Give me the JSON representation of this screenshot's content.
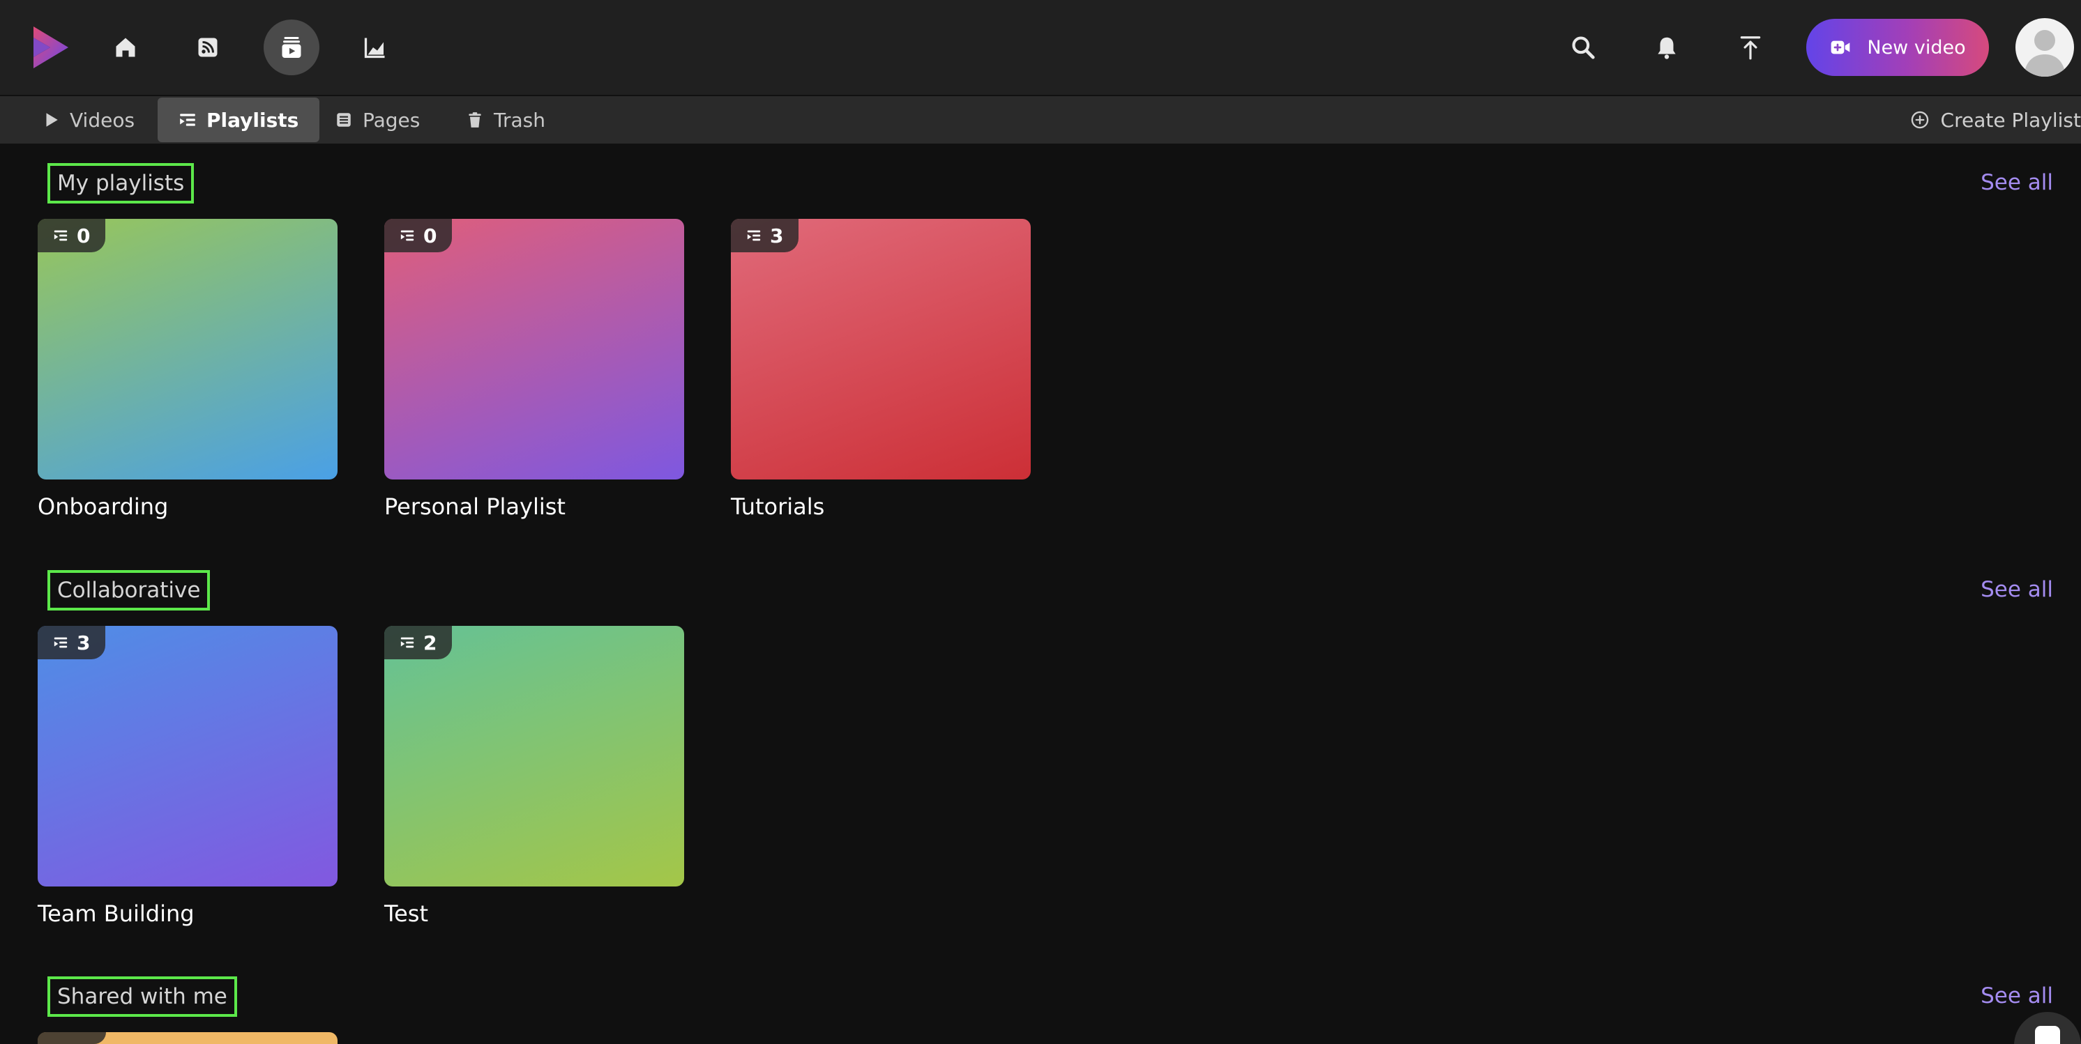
{
  "nav": {
    "items": [
      {
        "name": "home-icon"
      },
      {
        "name": "feed-icon"
      },
      {
        "name": "library-icon",
        "active": true
      },
      {
        "name": "analytics-icon"
      }
    ]
  },
  "header": {
    "new_video_label": "New video",
    "icons": [
      "search-icon",
      "bell-icon",
      "upload-icon"
    ]
  },
  "tabs": [
    {
      "label": "Videos",
      "icon": "play-icon"
    },
    {
      "label": "Playlists",
      "icon": "playlist-icon",
      "active": true
    },
    {
      "label": "Pages",
      "icon": "page-icon"
    },
    {
      "label": "Trash",
      "icon": "trash-icon"
    }
  ],
  "create_playlist_label": "Create Playlist",
  "sections": [
    {
      "title": "My playlists",
      "see_all": "See all",
      "cards": [
        {
          "title": "Onboarding",
          "count": "0",
          "gradient": [
            "#98c65a",
            "#4aa0e6"
          ]
        },
        {
          "title": "Personal Playlist",
          "count": "0",
          "gradient": [
            "#e05e7a",
            "#7e58e0"
          ]
        },
        {
          "title": "Tutorials",
          "count": "3",
          "gradient": [
            "#e06a7a",
            "#cc2f36"
          ]
        }
      ]
    },
    {
      "title": "Collaborative",
      "see_all": "See all",
      "cards": [
        {
          "title": "Team Building",
          "count": "3",
          "gradient": [
            "#4f8ee6",
            "#8258e0"
          ]
        },
        {
          "title": "Test",
          "count": "2",
          "gradient": [
            "#64c296",
            "#a4c648"
          ]
        }
      ]
    },
    {
      "title": "Shared with me",
      "see_all": "See all",
      "cards": [
        {
          "title": "",
          "count": "",
          "gradient": [
            "#f0b866",
            "#f0b866"
          ]
        }
      ]
    }
  ]
}
